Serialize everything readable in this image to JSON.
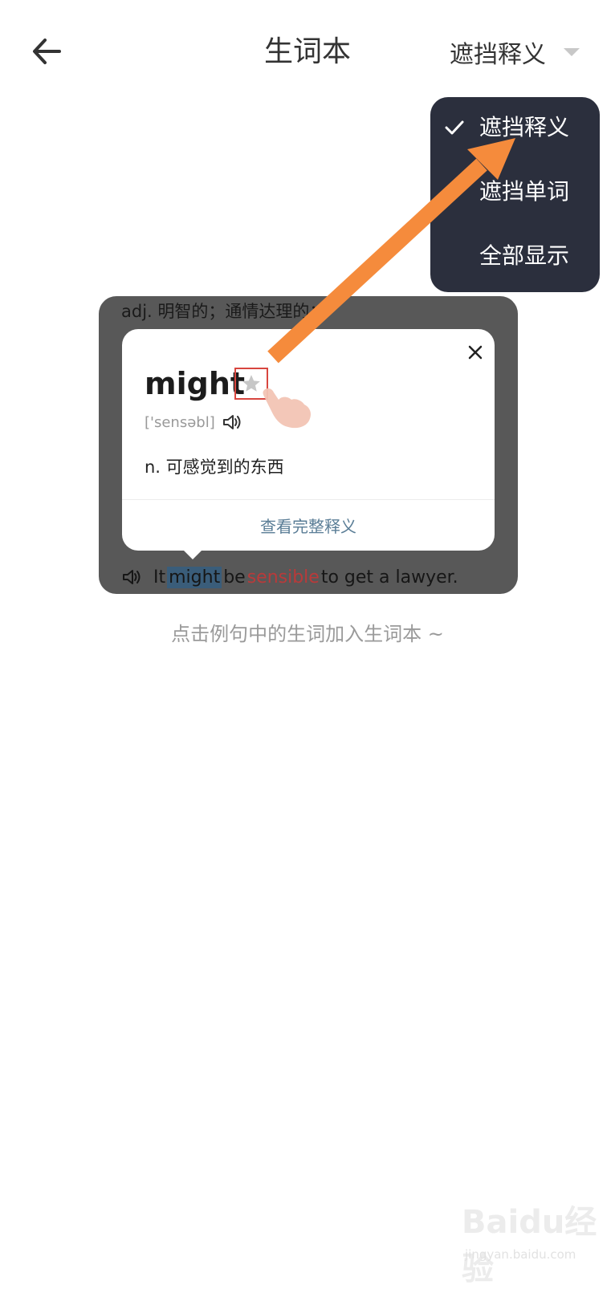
{
  "header": {
    "title": "生词本",
    "mode_selected": "遮挡释义"
  },
  "menu": {
    "items": [
      {
        "label": "遮挡释义",
        "checked": true
      },
      {
        "label": "遮挡单词",
        "checked": false
      },
      {
        "label": "全部显示",
        "checked": false
      }
    ]
  },
  "sample": {
    "meaning_line": "adj. 明智的；通情达理的；",
    "popup": {
      "word": "might",
      "phonetic": "['sensəbl]",
      "definition": "n. 可感觉到的东西",
      "full_link": "查看完整释义"
    },
    "sentence": {
      "w1": "It",
      "w2": "might",
      "w3": "be",
      "w4": "sensible",
      "w5": "to get a lawyer."
    }
  },
  "hint": "点击例句中的生词加入生词本 ~",
  "watermark": {
    "main": "Baidu经验",
    "sub": "jingyan.baidu.com"
  },
  "colors": {
    "menu_bg": "#2b2f3d",
    "arrow": "#f58b3c",
    "star_border": "#d8463f",
    "highlight": "#3a5d7a",
    "red_word": "#b93a3a"
  }
}
